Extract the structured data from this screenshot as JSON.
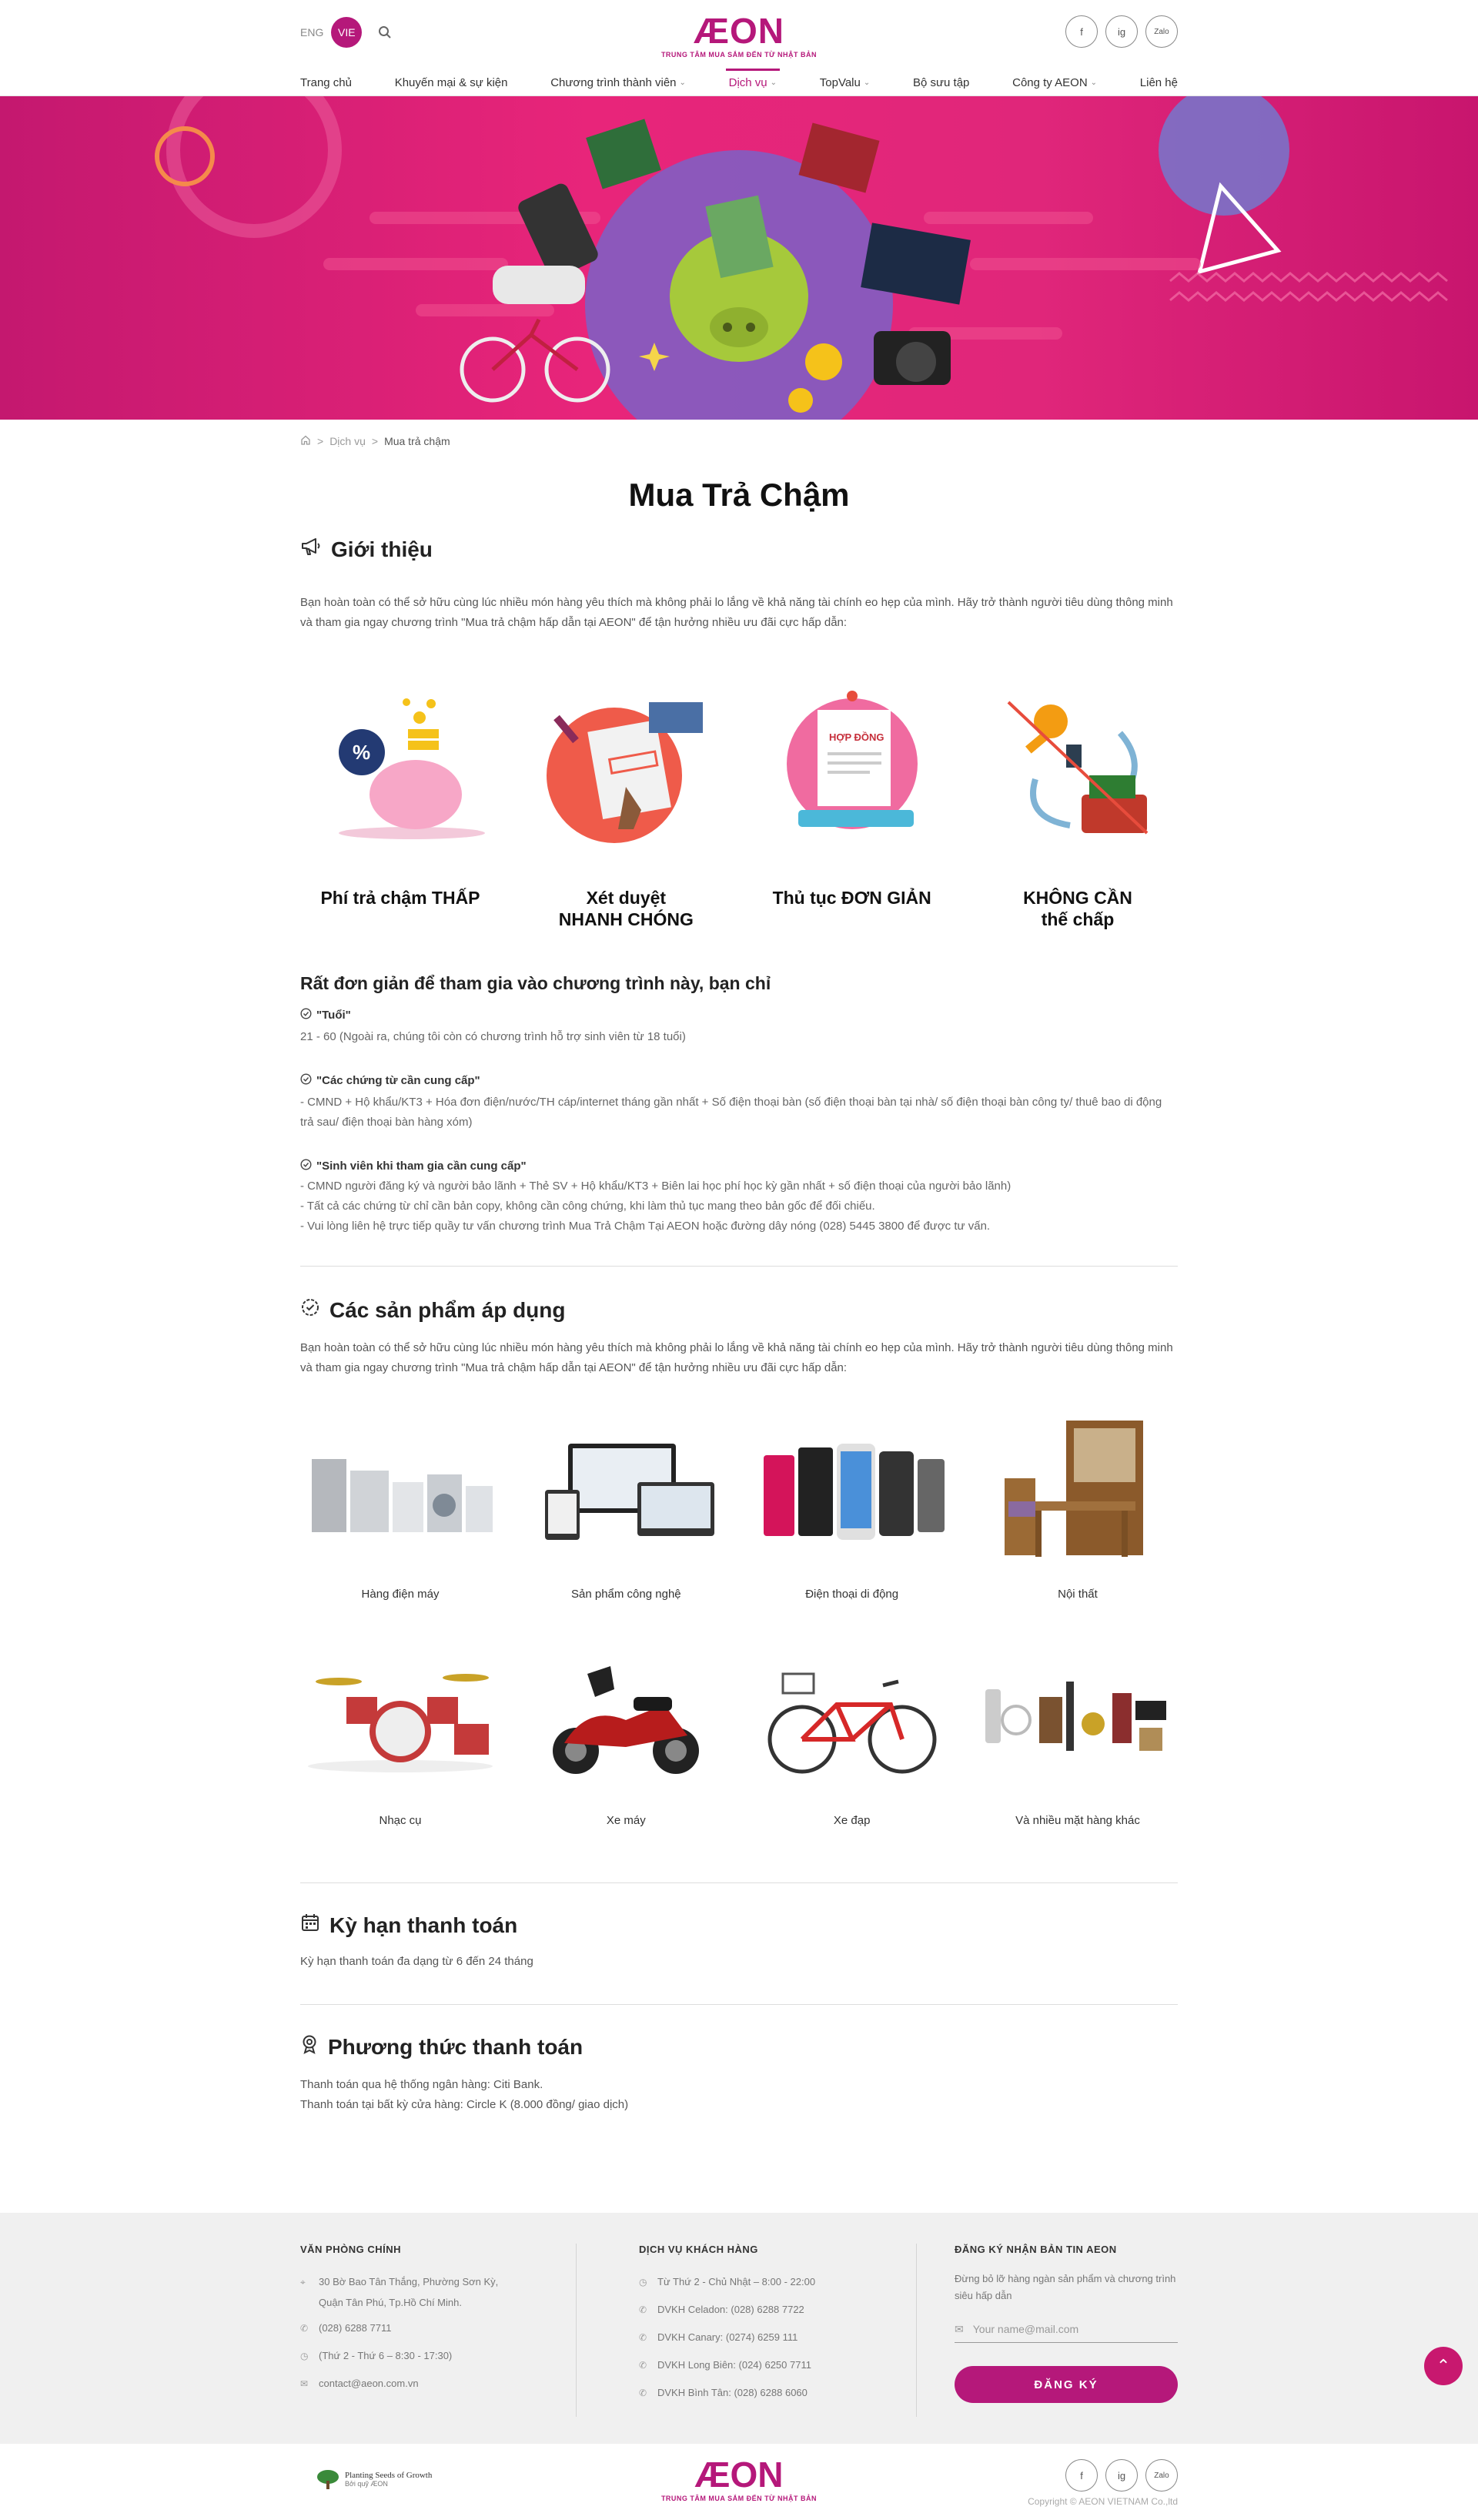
{
  "header": {
    "lang_eng": "ENG",
    "lang_vie": "VIE",
    "logo_text": "ÆON",
    "logo_tagline": "TRUNG TÂM MUA SẮM ĐẾN TỪ NHẬT BẢN",
    "social": [
      "f",
      "ig",
      "Zalo"
    ],
    "nav": [
      {
        "label": "Trang chủ",
        "dropdown": false,
        "active": false
      },
      {
        "label": "Khuyến mại & sự kiện",
        "dropdown": false,
        "active": false
      },
      {
        "label": "Chương trình thành viên",
        "dropdown": true,
        "active": false
      },
      {
        "label": "Dịch vụ",
        "dropdown": true,
        "active": true
      },
      {
        "label": "TopValu",
        "dropdown": true,
        "active": false
      },
      {
        "label": "Bộ sưu tập",
        "dropdown": false,
        "active": false
      },
      {
        "label": "Công ty AEON",
        "dropdown": true,
        "active": false
      },
      {
        "label": "Liên hệ",
        "dropdown": false,
        "active": false
      }
    ]
  },
  "breadcrumb": {
    "sep": ">",
    "level1": "Dịch vụ",
    "current": "Mua  trả chậm"
  },
  "page_title": "Mua Trả Chậm",
  "intro": {
    "heading": "Giới thiệu",
    "text": "Bạn hoàn toàn có thể sở hữu cùng lúc nhiều món hàng yêu thích mà không phải lo lắng về khả năng tài chính eo hẹp của mình. Hãy trở thành người tiêu dùng thông minh và tham gia ngay chương trình \"Mua trả chậm hấp dẫn tại AEON\" để tận hưởng nhiều ưu đãi cực hấp dẫn:"
  },
  "features": [
    {
      "line1": "Phí trả chậm THẤP",
      "line2": "",
      "icon": "piggy-bank-icon"
    },
    {
      "line1": "Xét duyệt",
      "line2": "NHANH CHÓNG",
      "icon": "approved-stamp-icon"
    },
    {
      "line1": "Thủ tục ĐƠN GIẢN",
      "line2": "",
      "icon": "contract-icon"
    },
    {
      "line1": "KHÔNG CẦN",
      "line2": "thế chấp",
      "icon": "no-collateral-icon"
    }
  ],
  "requirements": {
    "heading": "Rất đơn giản để tham gia vào chương trình này, bạn chỉ",
    "items": [
      {
        "q": "\"Tuổi\"",
        "a": [
          "21 - 60 (Ngoài ra, chúng tôi còn có chương trình hỗ trợ sinh viên từ 18 tuổi)"
        ]
      },
      {
        "q": "\"Các chứng từ cần cung cấp\"",
        "a": [
          "- CMND + Hộ khẩu/KT3 + Hóa đơn điện/nước/TH cáp/internet tháng gần nhất + Số điện thoại bàn (số điện thoại bàn tại nhà/ số điện thoại bàn công ty/ thuê bao di động trả sau/ điện thoại bàn hàng xóm)"
        ]
      },
      {
        "q": "\"Sinh viên khi tham gia cần cung cấp\"",
        "a": [
          "- CMND người đăng ký và người bảo lãnh + Thẻ SV + Hộ khẩu/KT3 + Biên lai học phí học kỳ gần nhất + số điện thoại của người bảo lãnh)",
          "- Tất cả các chứng từ chỉ cần bản copy, không cần công chứng, khi làm thủ tục mang theo bản gốc để đối chiếu.",
          "- Vui lòng liên hệ trực tiếp quầy tư vấn chương trình Mua Trả Chậm Tại AEON hoặc đường dây nóng (028) 5445 3800 để được tư vấn."
        ]
      }
    ]
  },
  "products": {
    "heading": "Các sản phẩm áp dụng",
    "text": "Bạn hoàn toàn có thể sở hữu cùng lúc nhiều món hàng yêu thích mà không phải lo lắng về khả năng tài chính eo hẹp của mình. Hãy trở thành người tiêu dùng thông minh và tham gia ngay chương trình \"Mua trả chậm hấp dẫn tại AEON\" để tận hưởng nhiều ưu đãi cực hấp dẫn:",
    "items": [
      {
        "label": "Hàng điện máy"
      },
      {
        "label": "Sản phẩm công nghệ"
      },
      {
        "label": "Điện thoại di động"
      },
      {
        "label": "Nội thất"
      },
      {
        "label": "Nhạc cụ"
      },
      {
        "label": "Xe máy"
      },
      {
        "label": "Xe đạp"
      },
      {
        "label": "Và nhiều mặt hàng khác"
      }
    ]
  },
  "term": {
    "heading": "Kỳ hạn thanh toán",
    "text": "Kỳ hạn thanh toán đa dạng từ 6 đến 24 tháng"
  },
  "payment": {
    "heading": "Phương thức thanh toán",
    "line1": "Thanh toán qua hệ thống ngân hàng: Citi Bank.",
    "line2": "Thanh toán tại bất kỳ cửa hàng: Circle K (8.000 đồng/ giao dịch)"
  },
  "footer": {
    "office": {
      "title": "VĂN PHÒNG CHÍNH",
      "address1": "30 Bờ Bao Tân Thắng, Phường Sơn Kỳ,",
      "address2": "Quận Tân Phú, Tp.Hồ Chí Minh.",
      "phone": "(028) 6288 7711",
      "hours": "(Thứ 2 - Thứ 6 – 8:30 - 17:30)",
      "email": "contact@aeon.com.vn"
    },
    "service": {
      "title": "DỊCH VỤ KHÁCH HÀNG",
      "lines": [
        "Từ Thứ 2 - Chủ Nhật – 8:00 - 22:00",
        "DVKH Celadon: (028) 6288 7722",
        "DVKH Canary: (0274) 6259 111",
        "DVKH Long Biên: (024) 6250 7711",
        "DVKH Bình Tân: (028) 6288 6060"
      ]
    },
    "newsletter": {
      "title": "ĐĂNG KÝ NHẬN BẢN TIN AEON",
      "desc": "Đừng bỏ lỡ hàng ngàn sản phẩm và chương trình siêu hấp dẫn",
      "placeholder": "Your name@mail.com",
      "button": "ĐĂNG KÝ"
    }
  },
  "bottom": {
    "seeds_title": "Planting Seeds of Growth",
    "seeds_sub": "Bởi quỹ ÆON",
    "copyright": "Copyright © AEON VIETNAM Co.,ltd"
  },
  "colors": {
    "brand": "#b5187a",
    "banner": "#e0267a"
  }
}
